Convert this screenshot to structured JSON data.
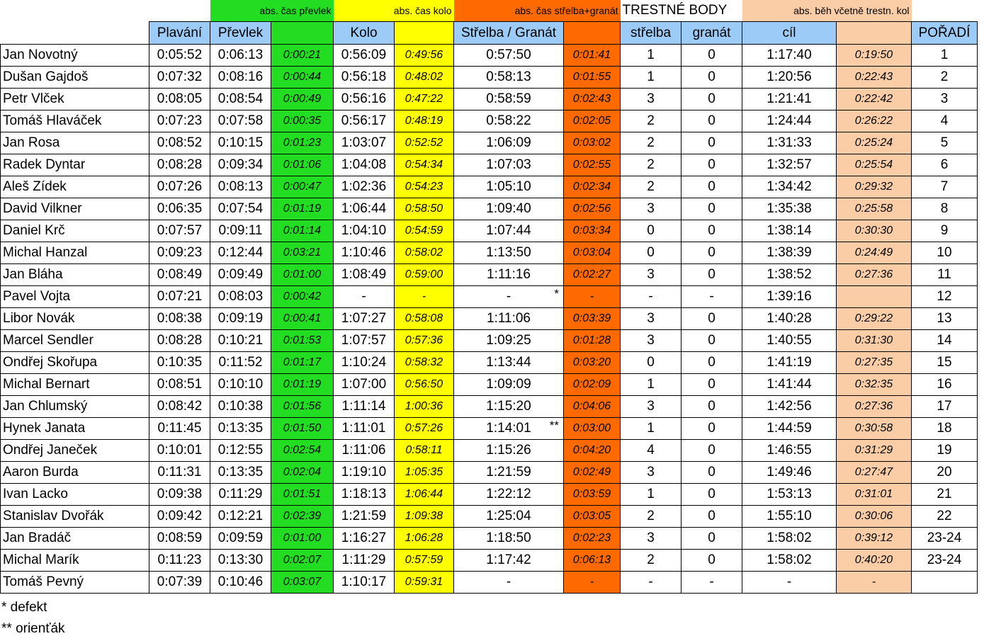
{
  "header_top": {
    "transition": "abs. čas převlek",
    "bike": "abs. čas kolo",
    "shoot_grenade": "abs. čas střelba+granát",
    "penalty": "TRESTNÉ BODY",
    "run": "abs. běh včetně trestn. kol"
  },
  "columns": {
    "swim": "Plavání",
    "transition": "Převlek",
    "bike": "Kolo",
    "shoot_grenade": "Střelba / Granát",
    "shooting": "střelba",
    "grenade": "granát",
    "finish": "cíl",
    "rank": "POŘADÍ"
  },
  "rows": [
    {
      "name": "Jan Novotný",
      "swim": "0:05:52",
      "trans": "0:06:13",
      "trans_abs": "0:00:21",
      "bike": "0:56:09",
      "bike_abs": "0:49:56",
      "shoot": "0:57:50",
      "mark": "",
      "shoot_abs": "0:01:41",
      "pen_s": "1",
      "pen_g": "0",
      "finish": "1:17:40",
      "run_abs": "0:19:50",
      "rank": "1"
    },
    {
      "name": "Dušan Gajdoš",
      "swim": "0:07:32",
      "trans": "0:08:16",
      "trans_abs": "0:00:44",
      "bike": "0:56:18",
      "bike_abs": "0:48:02",
      "shoot": "0:58:13",
      "mark": "",
      "shoot_abs": "0:01:55",
      "pen_s": "1",
      "pen_g": "0",
      "finish": "1:20:56",
      "run_abs": "0:22:43",
      "rank": "2"
    },
    {
      "name": "Petr Vlček",
      "swim": "0:08:05",
      "trans": "0:08:54",
      "trans_abs": "0:00:49",
      "bike": "0:56:16",
      "bike_abs": "0:47:22",
      "shoot": "0:58:59",
      "mark": "",
      "shoot_abs": "0:02:43",
      "pen_s": "3",
      "pen_g": "0",
      "finish": "1:21:41",
      "run_abs": "0:22:42",
      "rank": "3"
    },
    {
      "name": "Tomáš Hlaváček",
      "swim": "0:07:23",
      "trans": "0:07:58",
      "trans_abs": "0:00:35",
      "bike": "0:56:17",
      "bike_abs": "0:48:19",
      "shoot": "0:58:22",
      "mark": "",
      "shoot_abs": "0:02:05",
      "pen_s": "2",
      "pen_g": "0",
      "finish": "1:24:44",
      "run_abs": "0:26:22",
      "rank": "4"
    },
    {
      "name": "Jan Rosa",
      "swim": "0:08:52",
      "trans": "0:10:15",
      "trans_abs": "0:01:23",
      "bike": "1:03:07",
      "bike_abs": "0:52:52",
      "shoot": "1:06:09",
      "mark": "",
      "shoot_abs": "0:03:02",
      "pen_s": "2",
      "pen_g": "0",
      "finish": "1:31:33",
      "run_abs": "0:25:24",
      "rank": "5"
    },
    {
      "name": "Radek Dyntar",
      "swim": "0:08:28",
      "trans": "0:09:34",
      "trans_abs": "0:01:06",
      "bike": "1:04:08",
      "bike_abs": "0:54:34",
      "shoot": "1:07:03",
      "mark": "",
      "shoot_abs": "0:02:55",
      "pen_s": "2",
      "pen_g": "0",
      "finish": "1:32:57",
      "run_abs": "0:25:54",
      "rank": "6"
    },
    {
      "name": "Aleš Zídek",
      "swim": "0:07:26",
      "trans": "0:08:13",
      "trans_abs": "0:00:47",
      "bike": "1:02:36",
      "bike_abs": "0:54:23",
      "shoot": "1:05:10",
      "mark": "",
      "shoot_abs": "0:02:34",
      "pen_s": "2",
      "pen_g": "0",
      "finish": "1:34:42",
      "run_abs": "0:29:32",
      "rank": "7"
    },
    {
      "name": "David Vilkner",
      "swim": "0:06:35",
      "trans": "0:07:54",
      "trans_abs": "0:01:19",
      "bike": "1:06:44",
      "bike_abs": "0:58:50",
      "shoot": "1:09:40",
      "mark": "",
      "shoot_abs": "0:02:56",
      "pen_s": "3",
      "pen_g": "0",
      "finish": "1:35:38",
      "run_abs": "0:25:58",
      "rank": "8"
    },
    {
      "name": "Daniel Krč",
      "swim": "0:07:57",
      "trans": "0:09:11",
      "trans_abs": "0:01:14",
      "bike": "1:04:10",
      "bike_abs": "0:54:59",
      "shoot": "1:07:44",
      "mark": "",
      "shoot_abs": "0:03:34",
      "pen_s": "0",
      "pen_g": "0",
      "finish": "1:38:14",
      "run_abs": "0:30:30",
      "rank": "9"
    },
    {
      "name": "Michal Hanzal",
      "swim": "0:09:23",
      "trans": "0:12:44",
      "trans_abs": "0:03:21",
      "bike": "1:10:46",
      "bike_abs": "0:58:02",
      "shoot": "1:13:50",
      "mark": "",
      "shoot_abs": "0:03:04",
      "pen_s": "0",
      "pen_g": "0",
      "finish": "1:38:39",
      "run_abs": "0:24:49",
      "rank": "10"
    },
    {
      "name": "Jan Bláha",
      "swim": "0:08:49",
      "trans": "0:09:49",
      "trans_abs": "0:01:00",
      "bike": "1:08:49",
      "bike_abs": "0:59:00",
      "shoot": "1:11:16",
      "mark": "",
      "shoot_abs": "0:02:27",
      "pen_s": "3",
      "pen_g": "0",
      "finish": "1:38:52",
      "run_abs": "0:27:36",
      "rank": "11"
    },
    {
      "name": "Pavel Vojta",
      "swim": "0:07:21",
      "trans": "0:08:03",
      "trans_abs": "0:00:42",
      "bike": "-",
      "bike_abs": "-",
      "shoot": "-",
      "mark": "*",
      "shoot_abs": "-",
      "pen_s": "-",
      "pen_g": "-",
      "finish": "1:39:16",
      "run_abs": "",
      "rank": "12"
    },
    {
      "name": "Libor Novák",
      "swim": "0:08:38",
      "trans": "0:09:19",
      "trans_abs": "0:00:41",
      "bike": "1:07:27",
      "bike_abs": "0:58:08",
      "shoot": "1:11:06",
      "mark": "",
      "shoot_abs": "0:03:39",
      "pen_s": "3",
      "pen_g": "0",
      "finish": "1:40:28",
      "run_abs": "0:29:22",
      "rank": "13"
    },
    {
      "name": "Marcel Sendler",
      "swim": "0:08:28",
      "trans": "0:10:21",
      "trans_abs": "0:01:53",
      "bike": "1:07:57",
      "bike_abs": "0:57:36",
      "shoot": "1:09:25",
      "mark": "",
      "shoot_abs": "0:01:28",
      "pen_s": "3",
      "pen_g": "0",
      "finish": "1:40:55",
      "run_abs": "0:31:30",
      "rank": "14"
    },
    {
      "name": "Ondřej Skořupa",
      "swim": "0:10:35",
      "trans": "0:11:52",
      "trans_abs": "0:01:17",
      "bike": "1:10:24",
      "bike_abs": "0:58:32",
      "shoot": "1:13:44",
      "mark": "",
      "shoot_abs": "0:03:20",
      "pen_s": "0",
      "pen_g": "0",
      "finish": "1:41:19",
      "run_abs": "0:27:35",
      "rank": "15"
    },
    {
      "name": "Michal Bernart",
      "swim": "0:08:51",
      "trans": "0:10:10",
      "trans_abs": "0:01:19",
      "bike": "1:07:00",
      "bike_abs": "0:56:50",
      "shoot": "1:09:09",
      "mark": "",
      "shoot_abs": "0:02:09",
      "pen_s": "1",
      "pen_g": "0",
      "finish": "1:41:44",
      "run_abs": "0:32:35",
      "rank": "16"
    },
    {
      "name": "Jan Chlumský",
      "swim": "0:08:42",
      "trans": "0:10:38",
      "trans_abs": "0:01:56",
      "bike": "1:11:14",
      "bike_abs": "1:00:36",
      "shoot": "1:15:20",
      "mark": "",
      "shoot_abs": "0:04:06",
      "pen_s": "3",
      "pen_g": "0",
      "finish": "1:42:56",
      "run_abs": "0:27:36",
      "rank": "17"
    },
    {
      "name": "Hynek Janata",
      "swim": "0:11:45",
      "trans": "0:13:35",
      "trans_abs": "0:01:50",
      "bike": "1:11:01",
      "bike_abs": "0:57:26",
      "shoot": "1:14:01",
      "mark": "**",
      "shoot_abs": "0:03:00",
      "pen_s": "1",
      "pen_g": "0",
      "finish": "1:44:59",
      "run_abs": "0:30:58",
      "rank": "18"
    },
    {
      "name": "Ondřej Janeček",
      "swim": "0:10:01",
      "trans": "0:12:55",
      "trans_abs": "0:02:54",
      "bike": "1:11:06",
      "bike_abs": "0:58:11",
      "shoot": "1:15:26",
      "mark": "",
      "shoot_abs": "0:04:20",
      "pen_s": "4",
      "pen_g": "0",
      "finish": "1:46:55",
      "run_abs": "0:31:29",
      "rank": "19"
    },
    {
      "name": "Aaron Burda",
      "swim": "0:11:31",
      "trans": "0:13:35",
      "trans_abs": "0:02:04",
      "bike": "1:19:10",
      "bike_abs": "1:05:35",
      "shoot": "1:21:59",
      "mark": "",
      "shoot_abs": "0:02:49",
      "pen_s": "3",
      "pen_g": "0",
      "finish": "1:49:46",
      "run_abs": "0:27:47",
      "rank": "20"
    },
    {
      "name": "Ivan Lacko",
      "swim": "0:09:38",
      "trans": "0:11:29",
      "trans_abs": "0:01:51",
      "bike": "1:18:13",
      "bike_abs": "1:06:44",
      "shoot": "1:22:12",
      "mark": "",
      "shoot_abs": "0:03:59",
      "pen_s": "1",
      "pen_g": "0",
      "finish": "1:53:13",
      "run_abs": "0:31:01",
      "rank": "21"
    },
    {
      "name": "Stanislav Dvořák",
      "swim": "0:09:42",
      "trans": "0:12:21",
      "trans_abs": "0:02:39",
      "bike": "1:21:59",
      "bike_abs": "1:09:38",
      "shoot": "1:25:04",
      "mark": "",
      "shoot_abs": "0:03:05",
      "pen_s": "2",
      "pen_g": "0",
      "finish": "1:55:10",
      "run_abs": "0:30:06",
      "rank": "22"
    },
    {
      "name": "Jan Bradáč",
      "swim": "0:08:59",
      "trans": "0:09:59",
      "trans_abs": "0:01:00",
      "bike": "1:16:27",
      "bike_abs": "1:06:28",
      "shoot": "1:18:50",
      "mark": "",
      "shoot_abs": "0:02:23",
      "pen_s": "3",
      "pen_g": "0",
      "finish": "1:58:02",
      "run_abs": "0:39:12",
      "rank": "23-24"
    },
    {
      "name": "Michal Marík",
      "swim": "0:11:23",
      "trans": "0:13:30",
      "trans_abs": "0:02:07",
      "bike": "1:11:29",
      "bike_abs": "0:57:59",
      "shoot": "1:17:42",
      "mark": "",
      "shoot_abs": "0:06:13",
      "pen_s": "2",
      "pen_g": "0",
      "finish": "1:58:02",
      "run_abs": "0:40:20",
      "rank": "23-24"
    },
    {
      "name": "Tomáš Pevný",
      "swim": "0:07:39",
      "trans": "0:10:46",
      "trans_abs": "0:03:07",
      "bike": "1:10:17",
      "bike_abs": "0:59:31",
      "shoot": "-",
      "mark": "",
      "shoot_abs": "-",
      "pen_s": "-",
      "pen_g": "-",
      "finish": "-",
      "run_abs": "-",
      "rank": ""
    }
  ],
  "notes": [
    "* defekt",
    "** orienťák"
  ],
  "colors": {
    "green": "#22dd22",
    "yellow": "#ffff00",
    "orange": "#ff6a00",
    "peach": "#fbcda6",
    "blue": "#9ccbf7"
  }
}
